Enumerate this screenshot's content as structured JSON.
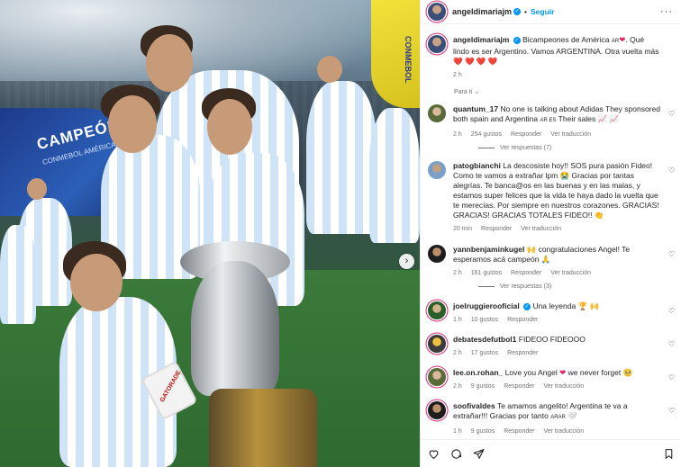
{
  "photo": {
    "banner_text": "CAMPEÓN",
    "banner_sub": "CONMEBOL AMÉRICA",
    "ball_text": "CONMEBOL",
    "bottle_label": "GATORADE"
  },
  "header": {
    "username": "angeldimariajm",
    "follow_label": "Seguir",
    "more_label": "···"
  },
  "caption": {
    "username": "angeldimariajm",
    "text_a": "Bicampeones de América",
    "flag": "AR",
    "text_b": ". Qué lindo es ser Argentino. Vamos ARGENTINA. Otra vuelta más",
    "hearts": "❤️ ❤️ ❤️ ❤️",
    "time": "2 h",
    "para_ti": "Para ti"
  },
  "comments": [
    {
      "username": "quantum_17",
      "text": "No one is talking about Adidas They sponsored both spain and Argentina",
      "flags": "AR ES",
      "text_after": "Their sales 📈 📈",
      "time": "2 h",
      "likes": "254 gustos",
      "reply": "Responder",
      "translate": "Ver traducción",
      "replies_label": "Ver respuestas (7)"
    },
    {
      "username": "patogbianchi",
      "text": "La descosiste hoy!! SOS pura pasión Fideo! Como te vamos a extrañar lpm 😭 Gracias por tantas alegrías. Te banca@os en las buenas y en las malas, y estamos super felices que la vida te haya dado la vuelta que te merecías. Por siempre en nuestros corazones. GRACIAS! GRACIAS! GRACIAS TOTALES FIDEO!!",
      "emoji": "👏",
      "time": "20 min",
      "reply": "Responder",
      "translate": "Ver traducción"
    },
    {
      "username": "yannbenjaminkugel",
      "text": "🙌 congratulaciones Angel! Te esperamos acá campeón",
      "emoji": "🙏",
      "time": "2 h",
      "likes": "161 gustos",
      "reply": "Responder",
      "translate": "Ver traducción",
      "replies_label": "Ver respuestas (3)"
    },
    {
      "username": "joelruggierooficial",
      "text": "Una leyenda",
      "emoji": "🏆 🙌",
      "time": "1 h",
      "likes": "10 gustos",
      "reply": "Responder"
    },
    {
      "username": "debatesdefutbol1",
      "text": "FIDEOO FIDEOOO",
      "time": "2 h",
      "likes": "17 gustos",
      "reply": "Responder"
    },
    {
      "username": "lee.on.rohan_",
      "text": "Love you Angel",
      "text_after": "we never forget 🥺",
      "time": "2 h",
      "likes": "9 gustos",
      "reply": "Responder",
      "translate": "Ver traducción"
    },
    {
      "username": "soofivaldes",
      "text": "Te amamos angelito! Argentina te va a extrañar!!! Gracias por tanto",
      "flag": "ARAR",
      "emoji": "🤍",
      "time": "1 h",
      "likes": "9 gustos",
      "reply": "Responder",
      "translate": "Ver traducción"
    }
  ],
  "colors": {
    "accent": "#0095f6",
    "heart": "#e0245e",
    "muted": "#737373"
  }
}
